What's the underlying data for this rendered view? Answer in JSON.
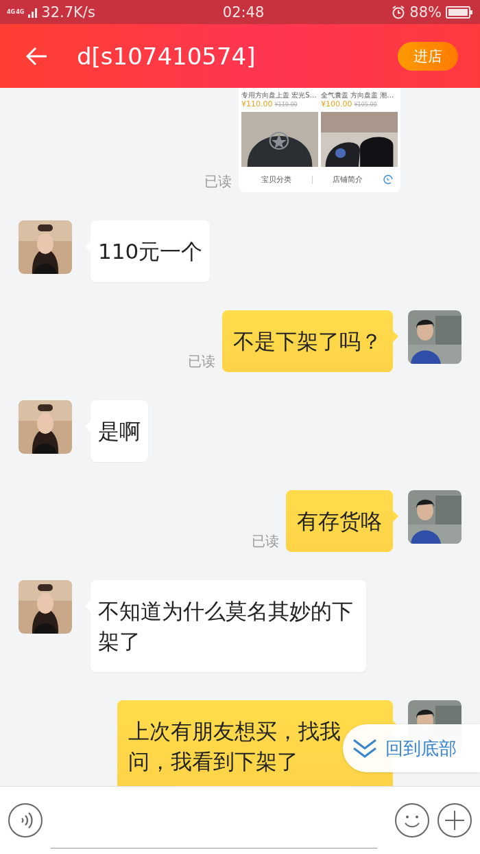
{
  "status_bar": {
    "network": [
      "4G",
      "4G"
    ],
    "speed": "32.7K/s",
    "time": "02:48",
    "battery": "88%"
  },
  "header": {
    "title": "d[s107410574]",
    "store_button": "进店"
  },
  "shop_card": {
    "read_receipt": "已读",
    "products": [
      {
        "title": "专用方向盘上盖 宏光S…",
        "price": "¥110.00",
        "old_price": "¥110.00"
      },
      {
        "title": "全气囊盖 方向盘盖 潮…",
        "price": "¥100.00",
        "old_price": "¥105.00"
      }
    ],
    "tabs": [
      "宝贝分类",
      "店铺简介"
    ]
  },
  "messages": [
    {
      "kind": "in",
      "text": "110元一个"
    },
    {
      "kind": "out",
      "text": "不是下架了吗？",
      "read_receipt": "已读"
    },
    {
      "kind": "in",
      "text": "是啊"
    },
    {
      "kind": "out",
      "text": "有存货咯",
      "read_receipt": "已读"
    },
    {
      "kind": "in",
      "text": "不知道为什么莫名其妙的下架了"
    },
    {
      "kind": "out",
      "text": "上次有朋友想买，找我问，我看到下架了"
    }
  ],
  "scroll_button": "回到底部"
}
